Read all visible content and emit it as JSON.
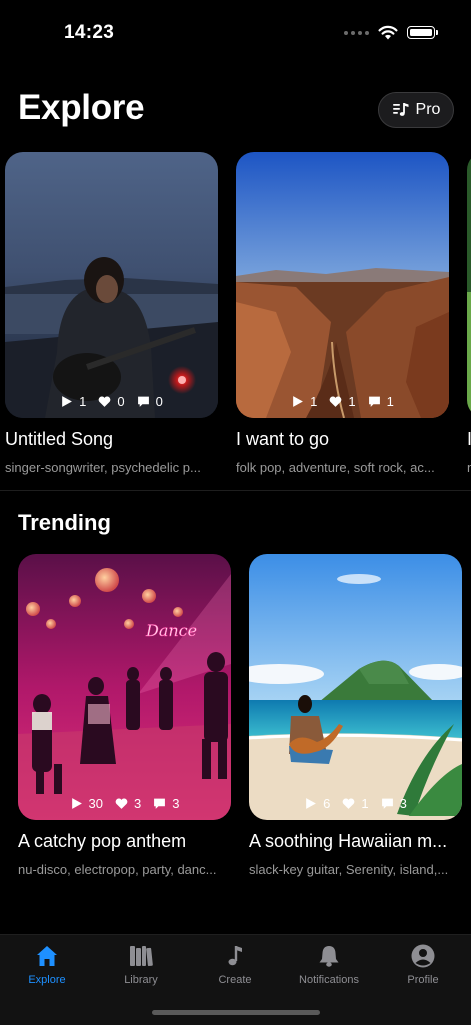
{
  "status": {
    "time": "14:23"
  },
  "header": {
    "title": "Explore",
    "pro_label": "Pro"
  },
  "explore_cards": [
    {
      "title": "Untitled Song",
      "tags": "singer-songwriter, psychedelic p...",
      "plays": "1",
      "likes": "0",
      "comments": "0"
    },
    {
      "title": "I want to go",
      "tags": "folk pop, adventure, soft rock, ac...",
      "plays": "1",
      "likes": "1",
      "comments": "1"
    },
    {
      "title": "I",
      "tags": "n"
    }
  ],
  "trending": {
    "title": "Trending",
    "cards": [
      {
        "title": "A catchy pop anthem",
        "tags": "nu-disco, electropop, party, danc...",
        "plays": "30",
        "likes": "3",
        "comments": "3",
        "neon_sign": "Dance"
      },
      {
        "title": "A soothing Hawaiian m...",
        "tags": "slack-key guitar, Serenity, island,...",
        "plays": "6",
        "likes": "1",
        "comments": "3"
      }
    ]
  },
  "tabs": [
    {
      "label": "Explore",
      "icon": "house-icon",
      "active": true
    },
    {
      "label": "Library",
      "icon": "books-icon",
      "active": false
    },
    {
      "label": "Create",
      "icon": "music-note-icon",
      "active": false
    },
    {
      "label": "Notifications",
      "icon": "bell-icon",
      "active": false
    },
    {
      "label": "Profile",
      "icon": "person-icon",
      "active": false
    }
  ],
  "colors": {
    "accent": "#1e90ff",
    "background": "#000000",
    "tab_bar": "#121212",
    "muted_text": "#9a9a9a"
  }
}
